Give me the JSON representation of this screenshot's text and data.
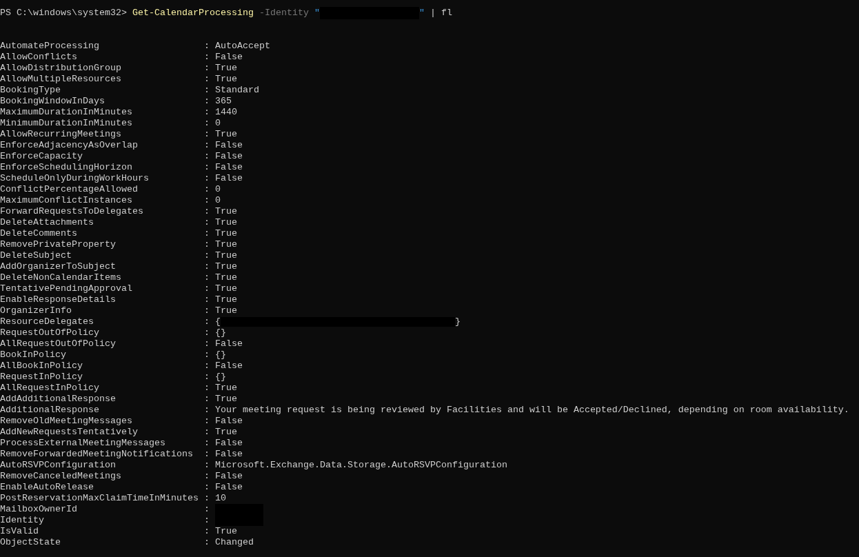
{
  "prompt": {
    "path": "PS C:\\windows\\system32>",
    "tokens": [
      {
        "kind": "command",
        "text": "Get-CalendarProcessing"
      },
      {
        "kind": "parameter",
        "text": "-Identity"
      },
      {
        "kind": "string_redacted",
        "open": "\"",
        "close": "\""
      },
      {
        "kind": "plain",
        "text": "| fl"
      }
    ]
  },
  "properties": [
    {
      "name": "AutomateProcessing",
      "colon": ":",
      "value": "AutoAccept"
    },
    {
      "name": "AllowConflicts",
      "colon": ":",
      "value": "False"
    },
    {
      "name": "AllowDistributionGroup",
      "colon": ":",
      "value": "True"
    },
    {
      "name": "AllowMultipleResources",
      "colon": ":",
      "value": "True"
    },
    {
      "name": "BookingType",
      "colon": ":",
      "value": "Standard"
    },
    {
      "name": "BookingWindowInDays",
      "colon": ":",
      "value": "365"
    },
    {
      "name": "MaximumDurationInMinutes",
      "colon": ":",
      "value": "1440"
    },
    {
      "name": "MinimumDurationInMinutes",
      "colon": ":",
      "value": "0"
    },
    {
      "name": "AllowRecurringMeetings",
      "colon": ":",
      "value": "True"
    },
    {
      "name": "EnforceAdjacencyAsOverlap",
      "colon": ":",
      "value": "False"
    },
    {
      "name": "EnforceCapacity",
      "colon": ":",
      "value": "False"
    },
    {
      "name": "EnforceSchedulingHorizon",
      "colon": ":",
      "value": "False"
    },
    {
      "name": "ScheduleOnlyDuringWorkHours",
      "colon": ":",
      "value": "False"
    },
    {
      "name": "ConflictPercentageAllowed",
      "colon": ":",
      "value": "0"
    },
    {
      "name": "MaximumConflictInstances",
      "colon": ":",
      "value": "0"
    },
    {
      "name": "ForwardRequestsToDelegates",
      "colon": ":",
      "value": "True"
    },
    {
      "name": "DeleteAttachments",
      "colon": ":",
      "value": "True"
    },
    {
      "name": "DeleteComments",
      "colon": ":",
      "value": "True"
    },
    {
      "name": "RemovePrivateProperty",
      "colon": ":",
      "value": "True"
    },
    {
      "name": "DeleteSubject",
      "colon": ":",
      "value": "True"
    },
    {
      "name": "AddOrganizerToSubject",
      "colon": ":",
      "value": "True"
    },
    {
      "name": "DeleteNonCalendarItems",
      "colon": ":",
      "value": "True"
    },
    {
      "name": "TentativePendingApproval",
      "colon": ":",
      "value": "True"
    },
    {
      "name": "EnableResponseDetails",
      "colon": ":",
      "value": "True"
    },
    {
      "name": "OrganizerInfo",
      "colon": ":",
      "value": "True"
    },
    {
      "name": "ResourceDelegates",
      "colon": ":",
      "kind": "redacted_list",
      "open": "{",
      "close": "}"
    },
    {
      "name": "RequestOutOfPolicy",
      "colon": ":",
      "value": "{}"
    },
    {
      "name": "AllRequestOutOfPolicy",
      "colon": ":",
      "value": "False"
    },
    {
      "name": "BookInPolicy",
      "colon": ":",
      "value": "{}"
    },
    {
      "name": "AllBookInPolicy",
      "colon": ":",
      "value": "False"
    },
    {
      "name": "RequestInPolicy",
      "colon": ":",
      "value": "{}"
    },
    {
      "name": "AllRequestInPolicy",
      "colon": ":",
      "value": "True"
    },
    {
      "name": "AddAdditionalResponse",
      "colon": ":",
      "value": "True"
    },
    {
      "name": "AdditionalResponse",
      "colon": ":",
      "value": "Your meeting request is being reviewed by Facilities and will be Accepted/Declined, depending on room availability."
    },
    {
      "name": "RemoveOldMeetingMessages",
      "colon": ":",
      "value": "False"
    },
    {
      "name": "AddNewRequestsTentatively",
      "colon": ":",
      "value": "True"
    },
    {
      "name": "ProcessExternalMeetingMessages",
      "colon": ":",
      "value": "False"
    },
    {
      "name": "RemoveForwardedMeetingNotifications",
      "colon": ":",
      "value": "False"
    },
    {
      "name": "AutoRSVPConfiguration",
      "colon": ":",
      "value": "Microsoft.Exchange.Data.Storage.AutoRSVPConfiguration"
    },
    {
      "name": "RemoveCanceledMeetings",
      "colon": ":",
      "value": "False"
    },
    {
      "name": "EnableAutoRelease",
      "colon": ":",
      "value": "False"
    },
    {
      "name": "PostReservationMaxClaimTimeInMinutes",
      "colon": ":",
      "value": "10"
    },
    {
      "name": "MailboxOwnerId",
      "colon": ":",
      "kind": "redacted"
    },
    {
      "name": "Identity",
      "colon": ":",
      "kind": "redacted"
    },
    {
      "name": "IsValid",
      "colon": ":",
      "value": "True"
    },
    {
      "name": "ObjectState",
      "colon": ":",
      "value": "Changed"
    }
  ]
}
